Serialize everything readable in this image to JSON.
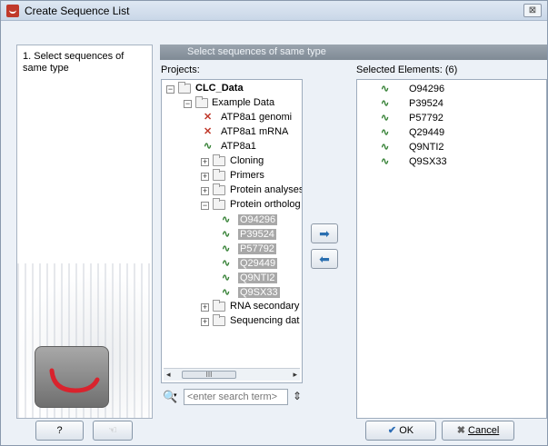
{
  "window": {
    "title": "Create Sequence List",
    "close_glyph": "⊠"
  },
  "left_panel": {
    "step": "1. Select sequences of same type"
  },
  "header": {
    "text": "Select sequences of same type"
  },
  "projects_label": "Projects:",
  "selected_label": "Selected Elements: (6)",
  "tree": {
    "root": "CLC_Data",
    "example": "Example Data",
    "atp_genomic": "ATP8a1 genomi",
    "atp_mrna": "ATP8a1 mRNA",
    "atp": "ATP8a1",
    "cloning": "Cloning",
    "primers": "Primers",
    "protein_analyses": "Protein analyses",
    "protein_orthologs": "Protein ortholog",
    "seq1": "O94296",
    "seq2": "P39524",
    "seq3": "P57792",
    "seq4": "Q29449",
    "seq5": "Q9NTI2",
    "seq6": "Q9SX33",
    "rna": "RNA secondary",
    "sequencing": "Sequencing dat"
  },
  "search": {
    "placeholder": "<enter search term>"
  },
  "selected": [
    "O94296",
    "P39524",
    "P57792",
    "Q29449",
    "Q9NTI2",
    "Q9SX33"
  ],
  "buttons": {
    "help": "?",
    "ok": "OK",
    "cancel": "Cancel"
  },
  "icons": {
    "app": "clc-logo-icon",
    "seq_green": "∿",
    "seq_red": "✕",
    "arrow_right": "➡",
    "arrow_left": "⬅",
    "scroll_mid": "III"
  }
}
